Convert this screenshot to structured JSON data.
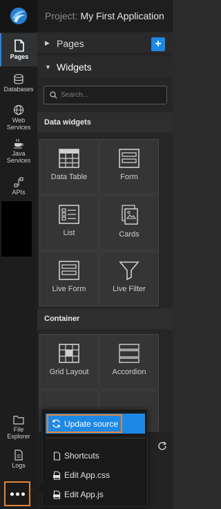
{
  "rail": {
    "items": [
      {
        "label": "Pages",
        "icon": "page-icon",
        "active": true
      },
      {
        "label": "Databases",
        "icon": "database-icon"
      },
      {
        "label": "Web Services",
        "icon": "globe-icon"
      },
      {
        "label": "Java Services",
        "icon": "coffee-cup-icon"
      },
      {
        "label": "APIs",
        "icon": "api-icon"
      },
      {
        "label": "File Explorer",
        "icon": "folder-icon"
      },
      {
        "label": "Logs",
        "icon": "document-icon"
      }
    ],
    "more_label": "•••"
  },
  "header": {
    "project_prefix": "Project:",
    "project_name": "My First Application"
  },
  "panel": {
    "pages_label": "Pages",
    "widgets_label": "Widgets",
    "add_label": "+",
    "search_placeholder": "Search...",
    "sections": {
      "data_widgets": "Data widgets",
      "container": "Container"
    },
    "tiles": {
      "data_table": "Data Table",
      "form": "Form",
      "list": "List",
      "cards": "Cards",
      "live_form": "Live Form",
      "live_filter": "Live Filter",
      "grid_layout": "Grid Layout",
      "accordion": "Accordion"
    }
  },
  "popup": {
    "update_source": "Update source",
    "shortcuts": "Shortcuts",
    "edit_css": "Edit App.css",
    "edit_js": "Edit App.js"
  },
  "colors": {
    "accent": "#1e88e5",
    "highlight": "#e2853a"
  }
}
